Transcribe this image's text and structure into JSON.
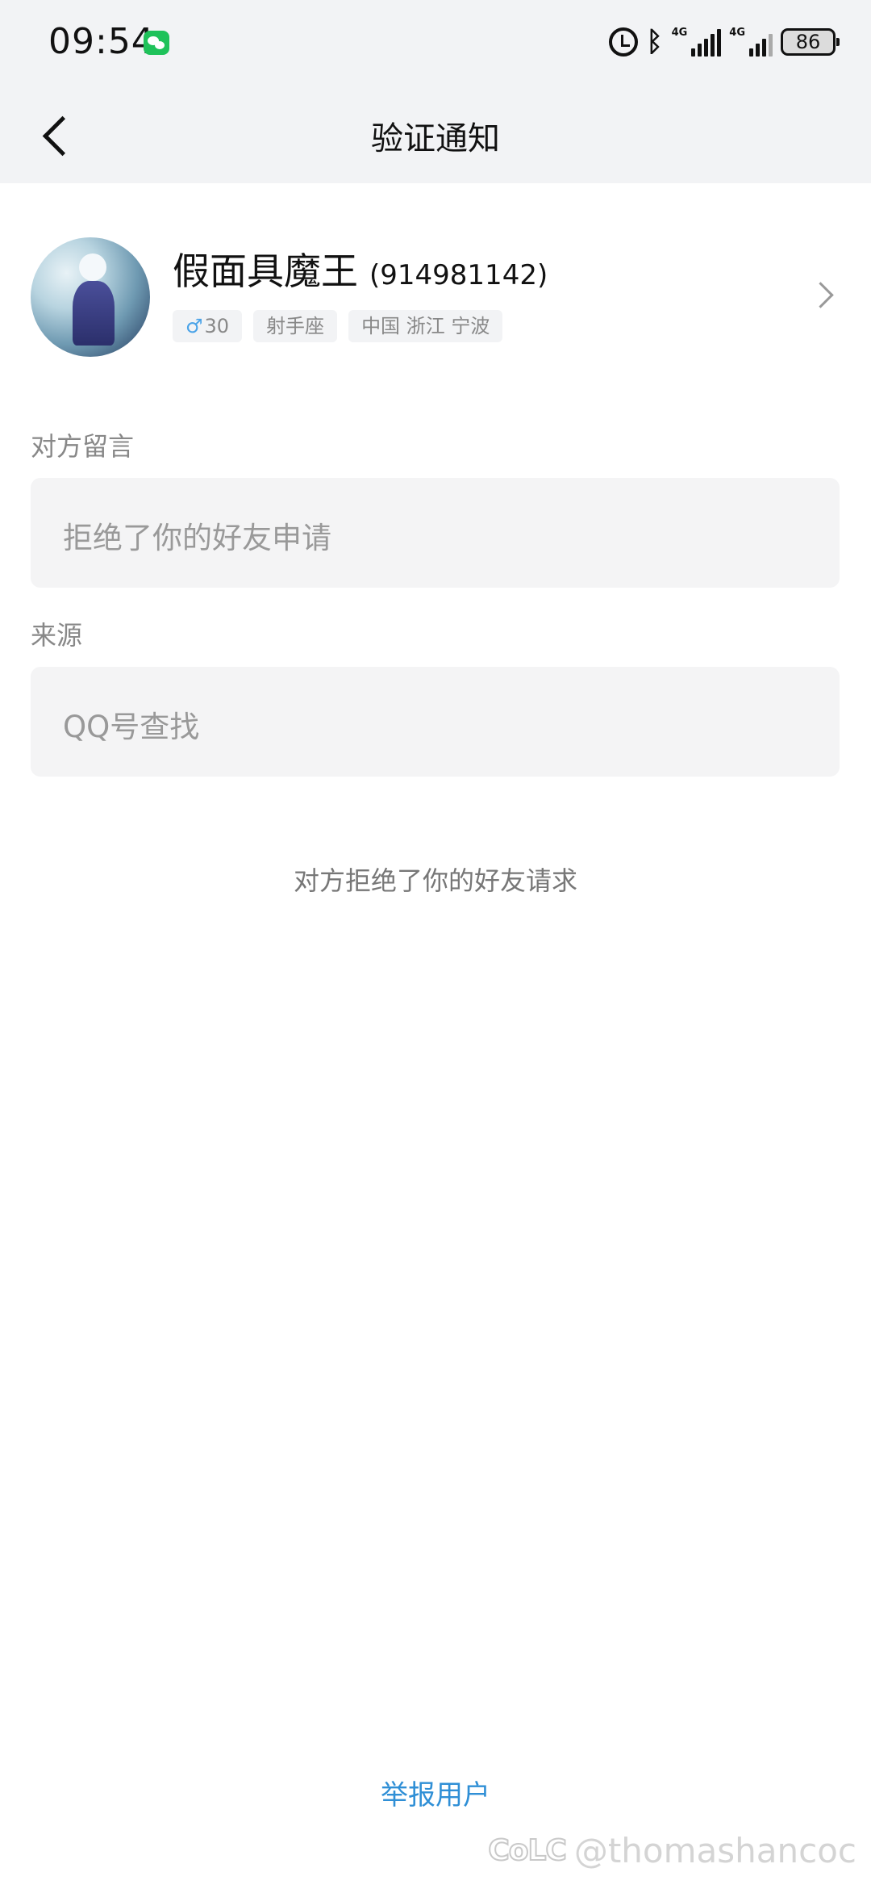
{
  "status_bar": {
    "time": "09:54",
    "network_1": "4G",
    "network_2": "4G",
    "battery": "86",
    "icons": [
      "wechat-icon",
      "alarm-icon",
      "bluetooth-icon",
      "signal-icon",
      "signal-icon",
      "battery-icon"
    ]
  },
  "nav": {
    "title": "验证通知",
    "back_icon": "chevron-left-icon"
  },
  "profile": {
    "name": "假面具魔王",
    "qq": "(914981142)",
    "gender_symbol": "♂",
    "age": "30",
    "zodiac": "射手座",
    "location": "中国 浙江 宁波"
  },
  "message_section": {
    "label": "对方留言",
    "value": "拒绝了你的好友申请"
  },
  "source_section": {
    "label": "来源",
    "value": "QQ号查找"
  },
  "status_message": "对方拒绝了你的好友请求",
  "report_label": "举报用户",
  "watermark": {
    "logo": "CoLC",
    "handle": "@thomashancoc"
  },
  "colors": {
    "link": "#2f8fd6",
    "background": "#ffffff",
    "bar_background": "#f2f3f5"
  }
}
